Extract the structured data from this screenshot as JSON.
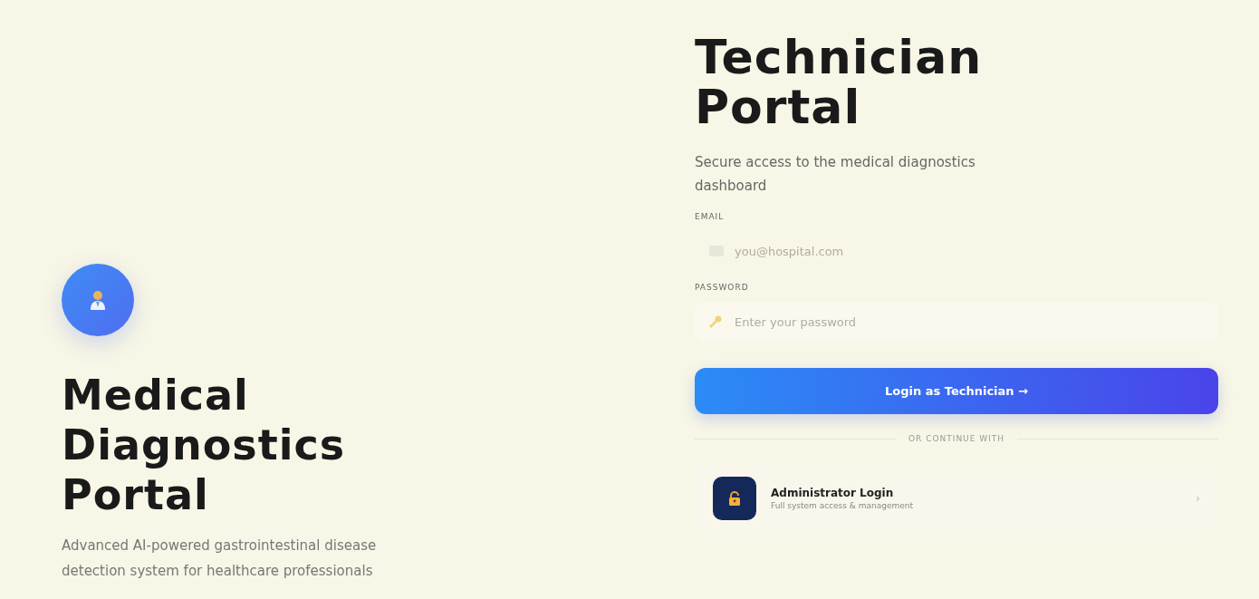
{
  "hero": {
    "title_lines": [
      "Medical",
      "Diagnostics",
      "Portal"
    ],
    "subtitle": "Advanced AI-powered gastrointestinal disease detection system for healthcare professionals"
  },
  "login": {
    "title_lines": [
      "Technician",
      "Portal"
    ],
    "subtitle": "Secure access to the medical diagnostics dashboard",
    "fields": [
      {
        "kind": "email",
        "label": "EMAIL",
        "placeholder": "you@hospital.com"
      },
      {
        "kind": "password",
        "label": "PASSWORD",
        "placeholder": "Enter your password"
      }
    ],
    "submit": "Login as Technician →",
    "divider": "OR CONTINUE WITH",
    "alternatives": [
      {
        "title": "Administrator Login",
        "subtitle": "Full system access & management",
        "chevron": "›"
      }
    ]
  }
}
